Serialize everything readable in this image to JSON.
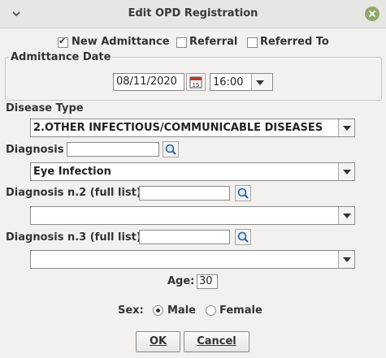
{
  "window": {
    "title": "Edit OPD Registration"
  },
  "options": {
    "new_admittance": {
      "label": "New Admittance",
      "checked": true
    },
    "referral": {
      "label": "Referral",
      "checked": false
    },
    "referred_to": {
      "label": "Referred To",
      "checked": false
    }
  },
  "admittance": {
    "legend": "Admittance Date",
    "date": "08/11/2020",
    "time": "16:00"
  },
  "disease_type": {
    "label": "Disease Type",
    "selected": "2.OTHER INFECTIOUS/COMMUNICABLE DISEASES"
  },
  "diagnosis": {
    "label": "Diagnosis",
    "search_value": "",
    "selected": "Eye Infection"
  },
  "diagnosis2": {
    "label": "Diagnosis n.2 (full list)",
    "search_value": "",
    "selected": ""
  },
  "diagnosis3": {
    "label": "Diagnosis n.3 (full list)",
    "search_value": "",
    "selected": ""
  },
  "age": {
    "label": "Age:",
    "value": "30"
  },
  "sex": {
    "label": "Sex:",
    "male": "Male",
    "female": "Female",
    "selected": "Male"
  },
  "buttons": {
    "ok": "OK",
    "cancel": "Cancel"
  },
  "colors": {
    "close_button": "#8fa86a",
    "title_bar": "#e8e6e4"
  }
}
